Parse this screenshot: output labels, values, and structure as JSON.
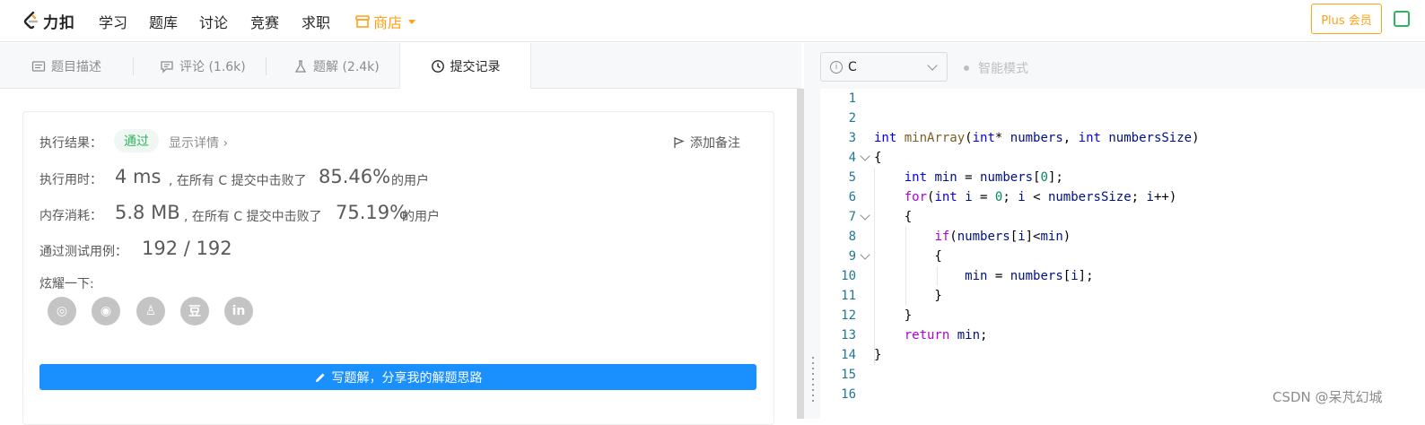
{
  "nav": {
    "logo_text": "力扣",
    "items": [
      "学习",
      "题库",
      "讨论",
      "竞赛",
      "求职"
    ],
    "store_label": "商店",
    "plus_label": "Plus 会员"
  },
  "tabs": [
    {
      "label": "题目描述",
      "icon": "description-icon"
    },
    {
      "label": "评论 (1.6k)",
      "icon": "comment-icon"
    },
    {
      "label": "题解 (2.4k)",
      "icon": "flask-icon"
    },
    {
      "label": "提交记录",
      "icon": "clock-icon",
      "active": true
    }
  ],
  "result": {
    "status_label": "执行结果：",
    "status_value": "通过",
    "detail_link": "显示详情 ›",
    "add_note": "添加备注",
    "runtime_label": "执行用时：",
    "runtime_value": "4 ms",
    "runtime_mid": ", 在所有 C 提交中击败了",
    "runtime_pct": "85.46%",
    "runtime_tail": "的用户",
    "memory_label": "内存消耗：",
    "memory_value": "5.8 MB",
    "memory_mid": ", 在所有 C 提交中击败了",
    "memory_pct": "75.19%",
    "memory_tail": "的用户",
    "tests_label": "通过测试用例：",
    "tests_value": "192 / 192",
    "share_label": "炫耀一下:",
    "write_solution": "写题解，分享我的解题思路"
  },
  "share_icons": [
    {
      "name": "wechat-icon",
      "glyph": "◎"
    },
    {
      "name": "weibo-icon",
      "glyph": "◉"
    },
    {
      "name": "qq-icon",
      "glyph": "♙"
    },
    {
      "name": "douban-icon",
      "glyph": "豆"
    },
    {
      "name": "linkedin-icon",
      "glyph": "in"
    }
  ],
  "editor": {
    "language": "C",
    "smart_mode": "智能模式",
    "line_numbers": [
      "1",
      "2",
      "3",
      "4",
      "5",
      "6",
      "7",
      "8",
      "9",
      "10",
      "11",
      "12",
      "13",
      "14",
      "15",
      "16"
    ]
  },
  "watermark": "CSDN @呆芃幻城",
  "colors": {
    "accent": "#ffa116",
    "primary": "#1a90ff",
    "pass": "#2db55d"
  }
}
